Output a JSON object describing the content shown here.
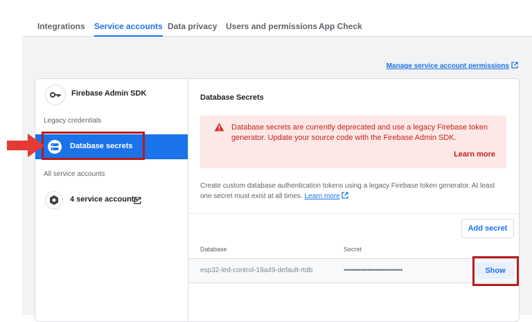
{
  "tabs": [
    {
      "label": "Integrations",
      "active": false
    },
    {
      "label": "Service accounts",
      "active": true
    },
    {
      "label": "Data privacy",
      "active": false
    },
    {
      "label": "Users and permissions",
      "active": false
    },
    {
      "label": "App Check",
      "active": false
    }
  ],
  "manage_link": "Manage service account permissions",
  "sidebar": {
    "admin_sdk": {
      "label": "Firebase Admin SDK",
      "icon": "key-icon"
    },
    "legacy_section": "Legacy credentials",
    "database_secrets": {
      "label": "Database secrets",
      "icon": "database-icon",
      "selected": true
    },
    "all_section": "All service accounts",
    "service_accounts": {
      "label": "4 service accounts",
      "icon": "service-account-icon"
    }
  },
  "main": {
    "title": "Database Secrets",
    "alert": {
      "message": "Database secrets are currently deprecated and use a legacy Firebase token generator. Update your source code with the Firebase Admin SDK.",
      "learn_more": "Learn more"
    },
    "description": "Create custom database authentication tokens using a legacy Firebase token generator. At least one secret must exist at all times.",
    "description_link": "Learn more",
    "add_secret": "Add secret",
    "table": {
      "headers": [
        "Database",
        "Secret"
      ],
      "rows": [
        {
          "database": "esp32-led-control-19a49-default-rtdb",
          "secret": "••••••••••••••••••••••••••••••••",
          "action": "Show"
        }
      ]
    }
  },
  "colors": {
    "accent": "#1a73e8",
    "alert_bg": "#fce8e6",
    "alert_text": "#c5221f",
    "annotation": "#b71c1c",
    "arrow": "#e53935"
  }
}
